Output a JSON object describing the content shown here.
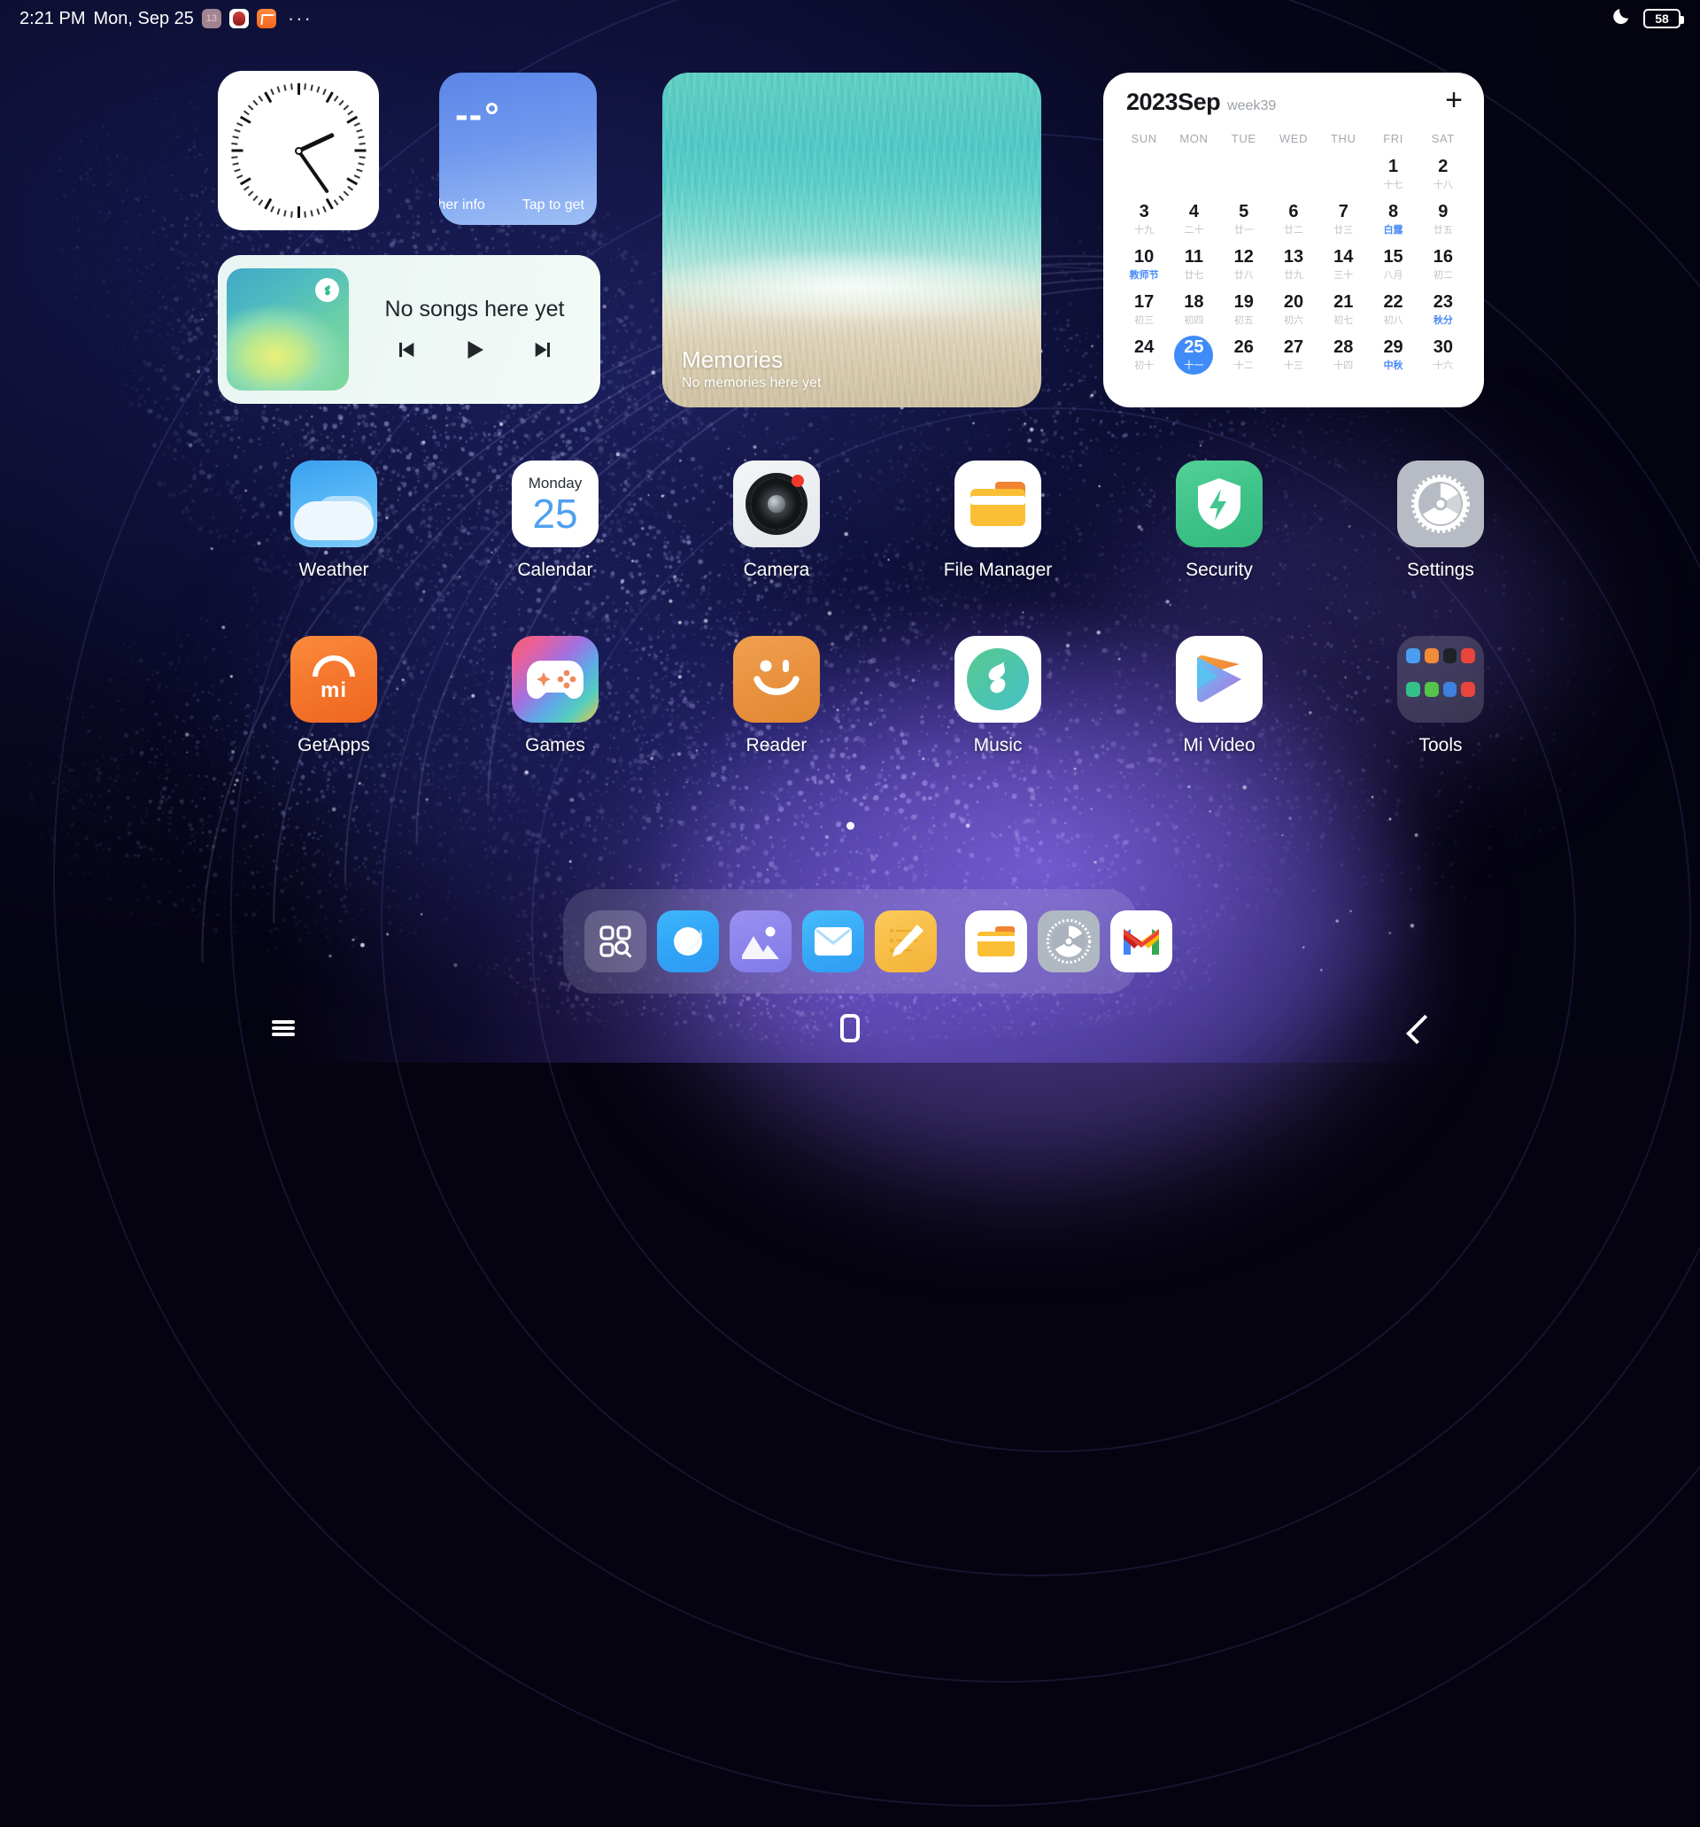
{
  "status_bar": {
    "time": "2:21 PM",
    "date": "Mon, Sep 25",
    "overflow_dots": "···",
    "notification_icons": [
      "calendar-notification-icon",
      "app-notification-icon",
      "orange-app-notification-icon"
    ],
    "dnd_icon": "moon-icon",
    "battery_level": "58"
  },
  "widgets": {
    "clock": {
      "name": "analog-clock-widget",
      "hour_hand_deg": -25,
      "minute_hand_deg": 55
    },
    "weather": {
      "temperature": "--",
      "degree_symbol": "°",
      "info_label": "ther info",
      "action_label": "Tap to get"
    },
    "memories": {
      "title": "Memories",
      "subtitle": "No memories here yet"
    },
    "music": {
      "title": "No songs here yet",
      "prev_label": "previous-track",
      "play_label": "play",
      "next_label": "next-track"
    },
    "calendar": {
      "month": "2023Sep",
      "week": "week39",
      "add_label": "+",
      "day_headers": [
        "SUN",
        "MON",
        "TUE",
        "WED",
        "THU",
        "FRI",
        "SAT"
      ],
      "leading_blanks": 5,
      "days": [
        {
          "num": "1",
          "lunar": "十七",
          "highlight": false,
          "today": false
        },
        {
          "num": "2",
          "lunar": "十八",
          "highlight": false,
          "today": false
        },
        {
          "num": "3",
          "lunar": "十九",
          "highlight": false,
          "today": false
        },
        {
          "num": "4",
          "lunar": "二十",
          "highlight": false,
          "today": false
        },
        {
          "num": "5",
          "lunar": "廿一",
          "highlight": false,
          "today": false
        },
        {
          "num": "6",
          "lunar": "廿二",
          "highlight": false,
          "today": false
        },
        {
          "num": "7",
          "lunar": "廿三",
          "highlight": false,
          "today": false
        },
        {
          "num": "8",
          "lunar": "白露",
          "highlight": true,
          "today": false
        },
        {
          "num": "9",
          "lunar": "廿五",
          "highlight": false,
          "today": false
        },
        {
          "num": "10",
          "lunar": "教师节",
          "highlight": true,
          "today": false
        },
        {
          "num": "11",
          "lunar": "廿七",
          "highlight": false,
          "today": false
        },
        {
          "num": "12",
          "lunar": "廿八",
          "highlight": false,
          "today": false
        },
        {
          "num": "13",
          "lunar": "廿九",
          "highlight": false,
          "today": false
        },
        {
          "num": "14",
          "lunar": "三十",
          "highlight": false,
          "today": false
        },
        {
          "num": "15",
          "lunar": "八月",
          "highlight": false,
          "today": false
        },
        {
          "num": "16",
          "lunar": "初二",
          "highlight": false,
          "today": false
        },
        {
          "num": "17",
          "lunar": "初三",
          "highlight": false,
          "today": false
        },
        {
          "num": "18",
          "lunar": "初四",
          "highlight": false,
          "today": false
        },
        {
          "num": "19",
          "lunar": "初五",
          "highlight": false,
          "today": false
        },
        {
          "num": "20",
          "lunar": "初六",
          "highlight": false,
          "today": false
        },
        {
          "num": "21",
          "lunar": "初七",
          "highlight": false,
          "today": false
        },
        {
          "num": "22",
          "lunar": "初八",
          "highlight": false,
          "today": false
        },
        {
          "num": "23",
          "lunar": "秋分",
          "highlight": true,
          "today": false
        },
        {
          "num": "24",
          "lunar": "初十",
          "highlight": false,
          "today": false
        },
        {
          "num": "25",
          "lunar": "十一",
          "highlight": false,
          "today": true
        },
        {
          "num": "26",
          "lunar": "十二",
          "highlight": false,
          "today": false
        },
        {
          "num": "27",
          "lunar": "十三",
          "highlight": false,
          "today": false
        },
        {
          "num": "28",
          "lunar": "十四",
          "highlight": false,
          "today": false
        },
        {
          "num": "29",
          "lunar": "中秋",
          "highlight": true,
          "today": false
        },
        {
          "num": "30",
          "lunar": "十六",
          "highlight": false,
          "today": false
        }
      ]
    }
  },
  "app_grid": {
    "row1": [
      {
        "label": "Weather",
        "icon": "weather-icon"
      },
      {
        "label": "Calendar",
        "icon": "calendar-icon",
        "day_of_week": "Monday",
        "day": "25"
      },
      {
        "label": "Camera",
        "icon": "camera-icon"
      },
      {
        "label": "File Manager",
        "icon": "file-manager-icon"
      },
      {
        "label": "Security",
        "icon": "security-shield-icon"
      },
      {
        "label": "Settings",
        "icon": "settings-gear-icon"
      }
    ],
    "row2": [
      {
        "label": "GetApps",
        "icon": "getapps-icon",
        "brand_text": "mi"
      },
      {
        "label": "Games",
        "icon": "games-gamepad-icon"
      },
      {
        "label": "Reader",
        "icon": "reader-smiley-icon"
      },
      {
        "label": "Music",
        "icon": "music-note-icon"
      },
      {
        "label": "Mi Video",
        "icon": "mi-video-play-icon"
      },
      {
        "label": "Tools",
        "icon": "tools-folder-icon"
      }
    ]
  },
  "tools_folder": {
    "mini_icons": [
      {
        "name": "contacts-mini-icon",
        "color": "#4a9ef0"
      },
      {
        "name": "calculator-mini-icon",
        "color": "#f08b37"
      },
      {
        "name": "recorder-mini-icon",
        "color": "#1f2126"
      },
      {
        "name": "clock-mini-icon",
        "color": "#e8453c"
      },
      {
        "name": "scanner-mini-icon",
        "color": "#34c08a"
      },
      {
        "name": "downloads-mini-icon",
        "color": "#56c34a"
      },
      {
        "name": "compass-mini-icon",
        "color": "#3f7fe0"
      },
      {
        "name": "feedback-mini-icon",
        "color": "#e8453c"
      }
    ]
  },
  "page_indicator": {
    "pages": 1,
    "current": 0
  },
  "dock": {
    "items": [
      {
        "name": "app-drawer-icon",
        "label": "App Drawer"
      },
      {
        "name": "browser-icon",
        "label": "Browser"
      },
      {
        "name": "gallery-icon",
        "label": "Gallery"
      },
      {
        "name": "mail-icon",
        "label": "Mail"
      },
      {
        "name": "notes-icon",
        "label": "Notes"
      }
    ],
    "pinned": [
      {
        "name": "file-manager-icon",
        "label": "File Manager"
      },
      {
        "name": "settings-icon",
        "label": "Settings"
      },
      {
        "name": "gmail-icon",
        "label": "Gmail"
      }
    ]
  },
  "nav_bar": {
    "recents_label": "Recents",
    "home_label": "Home",
    "back_label": "Back"
  },
  "colors": {
    "accent_blue": "#3f8cf8",
    "lunar_highlight": "#4a8cf7",
    "security_green": "#3fc389",
    "getapps_orange": "#f4762c"
  }
}
